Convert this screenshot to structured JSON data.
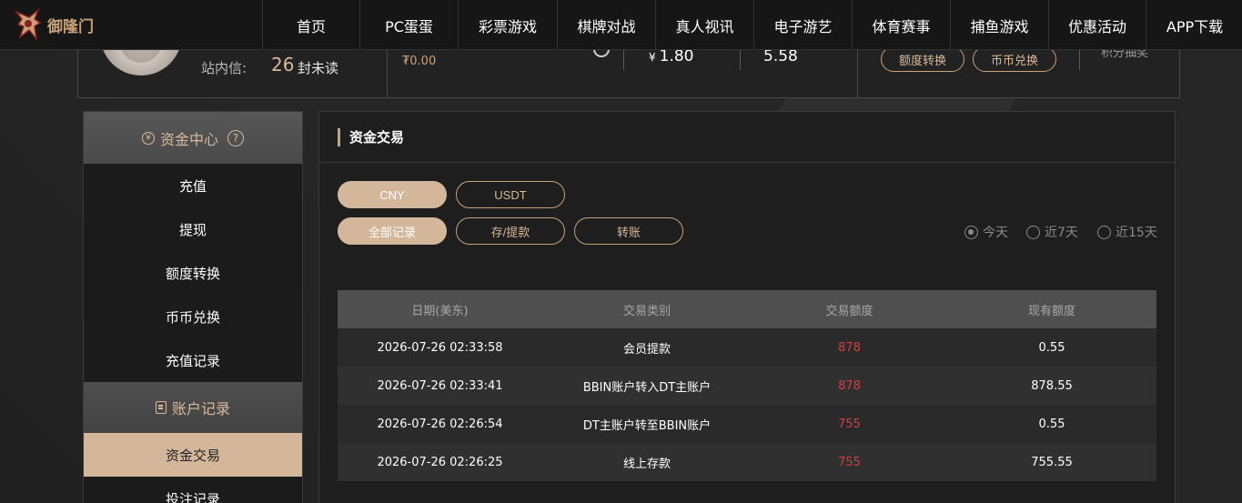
{
  "brand": {
    "name": "御隆门"
  },
  "nav": {
    "items": [
      {
        "label": "首页",
        "width": 107
      },
      {
        "label": "PC蛋蛋",
        "width": 108
      },
      {
        "label": "彩票游戏",
        "width": 109
      },
      {
        "label": "棋牌对战",
        "width": 108
      },
      {
        "label": "真人视讯",
        "width": 108
      },
      {
        "label": "电子游艺",
        "width": 108
      },
      {
        "label": "体育赛事",
        "width": 108
      },
      {
        "label": "捕鱼游戏",
        "width": 108
      },
      {
        "label": "优惠活动",
        "width": 107
      },
      {
        "label": "APP下载",
        "width": 107
      }
    ]
  },
  "profile": {
    "mail_label": "站内信:",
    "mail_count": "26",
    "mail_unit": "封未读",
    "balance_small": "₮0.00",
    "yen_symbol": "¥",
    "yen_value": "1.80",
    "points_value": "5.58",
    "transfer_button": "额度转换",
    "exchange_button": "币币兑换",
    "points_lottery": "积分抽奖"
  },
  "sidebar": {
    "funds_heading": "资金中心",
    "funds_items": [
      "充值",
      "提现",
      "额度转换",
      "币币兑换",
      "充值记录"
    ],
    "records_heading": "账户记录",
    "records_items": [
      "资金交易",
      "投注记录"
    ],
    "active_item": "资金交易"
  },
  "main": {
    "title": "资金交易",
    "currency_tabs": [
      "CNY",
      "USDT"
    ],
    "record_tabs": [
      "全部记录",
      "存/提款",
      "转账"
    ],
    "range_options": [
      "今天",
      "近7天",
      "近15天"
    ],
    "selected_range": "今天"
  },
  "table": {
    "headers": [
      "日期(美东)",
      "交易类别",
      "交易额度",
      "现有额度"
    ],
    "rows": [
      [
        "2026-07-26 02:33:58",
        "会员提款",
        "878",
        "0.55"
      ],
      [
        "2026-07-26 02:33:41",
        "BBIN账户转入DT主账户",
        "878",
        "878.55"
      ],
      [
        "2026-07-26 02:26:54",
        "DT主账户转至BBIN账户",
        "755",
        "0.55"
      ],
      [
        "2026-07-26 02:26:25",
        "线上存款",
        "755",
        "755.55"
      ]
    ]
  },
  "colors": {
    "accent": "#c9a27a",
    "active_fill": "#d4b69a",
    "amount": "#e0393e"
  }
}
